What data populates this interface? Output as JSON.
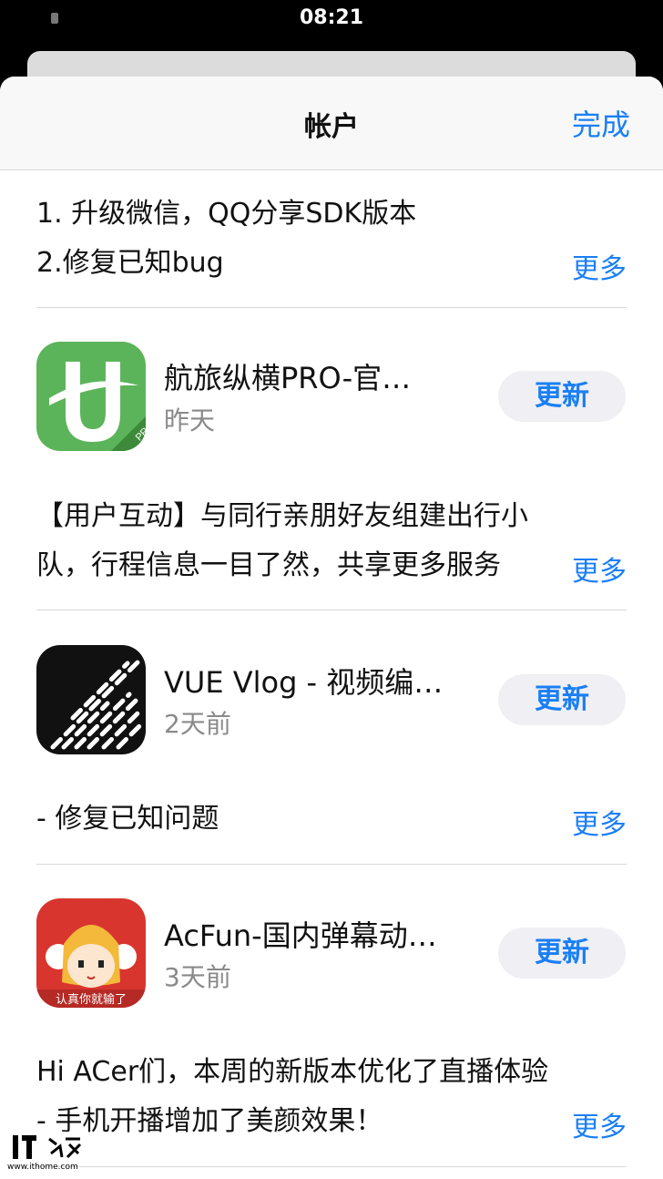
{
  "status_bar": {
    "time": "08:21"
  },
  "nav": {
    "title": "帐户",
    "done": "完成"
  },
  "top_note": {
    "line1": "1. 升级微信，QQ分享SDK版本",
    "line2": "2.修复已知bug",
    "more": "更多"
  },
  "apps": [
    {
      "name": "航旅纵横PRO-官…",
      "date": "昨天",
      "button": "更新",
      "icon": "hanglv-zongheng-icon",
      "icon_badge": "PRO",
      "note_line1": "【用户互动】与同行亲朋好友组建出行小",
      "note_line2": "队，行程信息一目了然，共享更多服务",
      "more": "更多"
    },
    {
      "name": "VUE Vlog - 视频编…",
      "date": "2天前",
      "button": "更新",
      "icon": "vue-vlog-icon",
      "note_line1": "- 修复已知问题",
      "more": "更多"
    },
    {
      "name": "AcFun-国内弹幕动…",
      "date": "3天前",
      "button": "更新",
      "icon": "acfun-icon",
      "icon_text": "认真你就输了",
      "note_line1": "Hi ACer们，本周的新版本优化了直播体验",
      "note_line2": "- 手机开播增加了美颜效果！",
      "more": "更多"
    }
  ],
  "watermark": {
    "logo": "IT之家",
    "url": "www.ithome.com"
  },
  "colors": {
    "accent": "#1a7ff5",
    "hanglv_green": "#5cb45a",
    "vue_black": "#111111",
    "acfun_red": "#d9352f"
  }
}
